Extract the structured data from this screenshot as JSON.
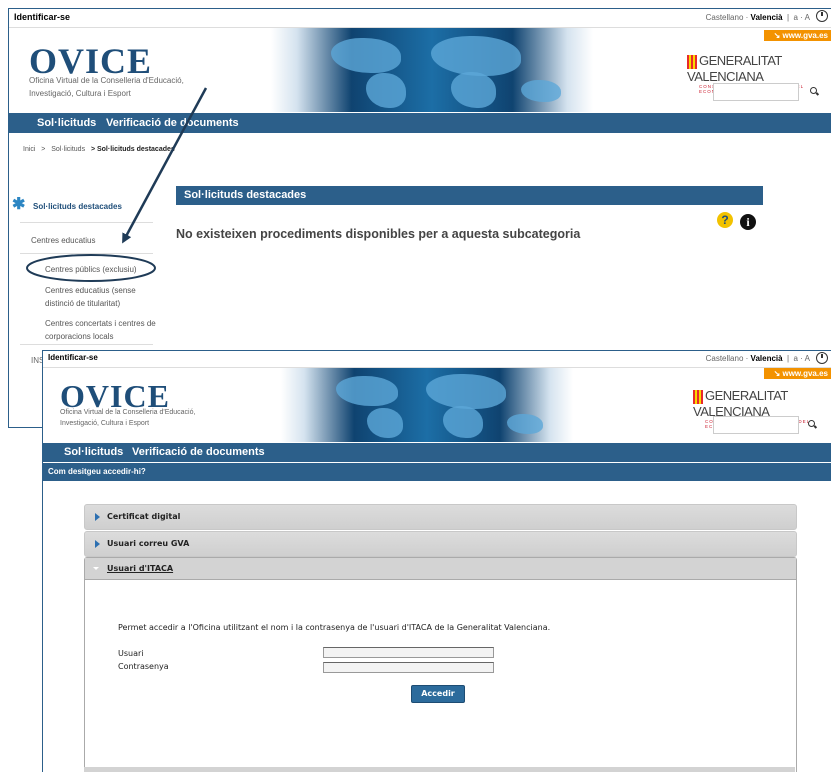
{
  "shot1": {
    "topbar": {
      "login": "Identificar-se",
      "lang_castellano": "Castellano",
      "lang_sep": "·",
      "lang_valencia": "Valencià",
      "font_size": "a · A"
    },
    "brand": {
      "logo": "OVICE",
      "subtitle_1": "Oficina Virtual de la Conselleria d'Educació,",
      "subtitle_2": "Investigació, Cultura i Esport"
    },
    "gva": {
      "link": "↘ www.gva.es",
      "name": "GENERALITAT VALENCIANA",
      "conselleria": "CONSELLERIA D'HISENDA I MODEL ECONÒMIC"
    },
    "nav": {
      "solicituds": "Sol·licituds",
      "verificacio": "Verificació de documents"
    },
    "breadcrumb": {
      "inici": "Inici",
      "sep": ">",
      "solicituds": "Sol·licituds",
      "current": "> Sol·licituds destacades"
    },
    "sidebar": {
      "title": "Sol·licituds destacades",
      "items": [
        {
          "label": "Centres educatius"
        },
        {
          "label": "Centres públics (exclusiu)"
        },
        {
          "label": "Centres educatius (sense distinció de titularitat)"
        },
        {
          "label": "Centres concertats i centres de corporacions locals"
        },
        {
          "label": "INS"
        }
      ]
    },
    "content": {
      "heading": "Sol·licituds destacades",
      "message": "No existeixen procediments disponibles per a aquesta subcategoria",
      "help": "?",
      "info": "i"
    }
  },
  "shot2": {
    "topbar": {
      "login": "Identificar-se",
      "lang_castellano": "Castellano",
      "lang_sep": "·",
      "lang_valencia": "Valencià",
      "font_size": "a · A"
    },
    "brand": {
      "logo": "OVICE",
      "subtitle_1": "Oficina Virtual de la Conselleria d'Educació,",
      "subtitle_2": "Investigació, Cultura i Esport"
    },
    "gva": {
      "link": "↘ www.gva.es",
      "name": "GENERALITAT VALENCIANA",
      "conselleria": "CONSELLERIA D'HISENDA I MODEL ECONÒMIC"
    },
    "nav": {
      "solicituds": "Sol·licituds",
      "verificacio": "Verificació de documents"
    },
    "question": "Com desitgeu accedir-hi?",
    "options": [
      {
        "label": "Certificat digital"
      },
      {
        "label": "Usuari correu GVA"
      },
      {
        "label": "Usuari d'ITACA"
      }
    ],
    "itaca": {
      "description": "Permet accedir a l'Oficina utilitzant el nom i la contrasenya de l'usuari d'ITACA de la Generalitat Valenciana.",
      "user_label": "Usuari",
      "user_value": "",
      "password_label": "Contrasenya",
      "password_value": "",
      "submit": "Accedir"
    }
  },
  "colors": {
    "nav_blue": "#2c5f8a",
    "gva_orange": "#f39200",
    "annotation": "#1f3b57"
  }
}
